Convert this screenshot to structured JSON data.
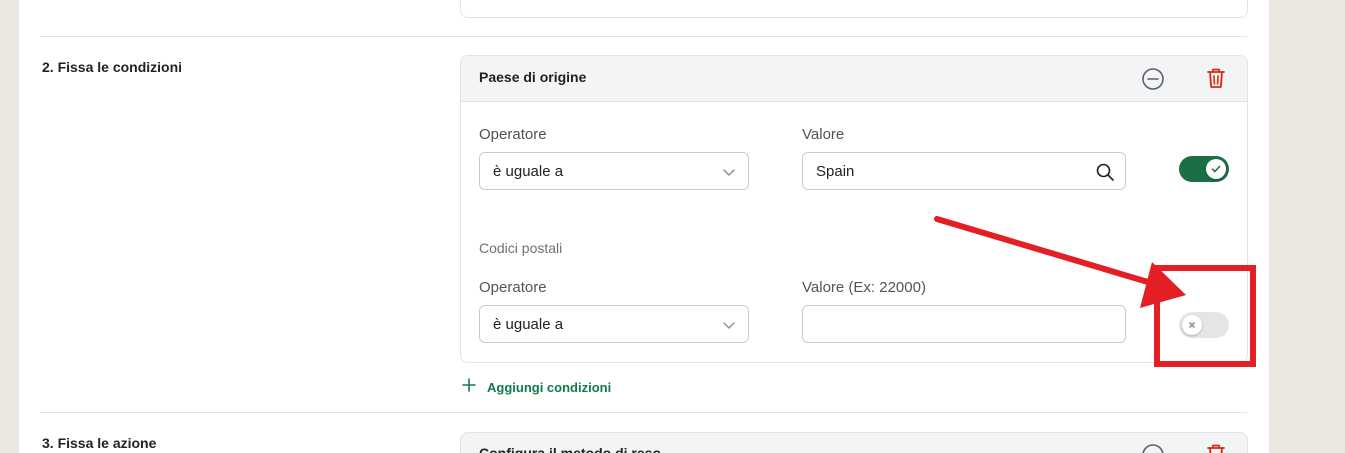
{
  "sections": {
    "conditions": {
      "title": "2. Fissa le condizioni",
      "card": {
        "title": "Paese di origine",
        "icons": {
          "collapse": "minus-circle-icon",
          "delete": "trash-icon"
        },
        "country": {
          "operator_label": "Operatore",
          "operator_value": "è uguale a",
          "value_label": "Valore",
          "value": "Spain",
          "toggle_on": true
        },
        "postal": {
          "title": "Codici postali",
          "operator_label": "Operatore",
          "operator_value": "è uguale a",
          "value_label": "Valore (Ex: 22000)",
          "value": "",
          "toggle_on": false
        }
      },
      "add_condition": "Aggiungi condizioni"
    },
    "actions": {
      "title": "3. Fissa le azione",
      "card_title": "Configura il metodo di reso"
    }
  },
  "colors": {
    "accent_green": "#1a7044",
    "link_green": "#137a4c",
    "danger_red": "#d72c0d",
    "annotation_red": "#e31e24"
  }
}
